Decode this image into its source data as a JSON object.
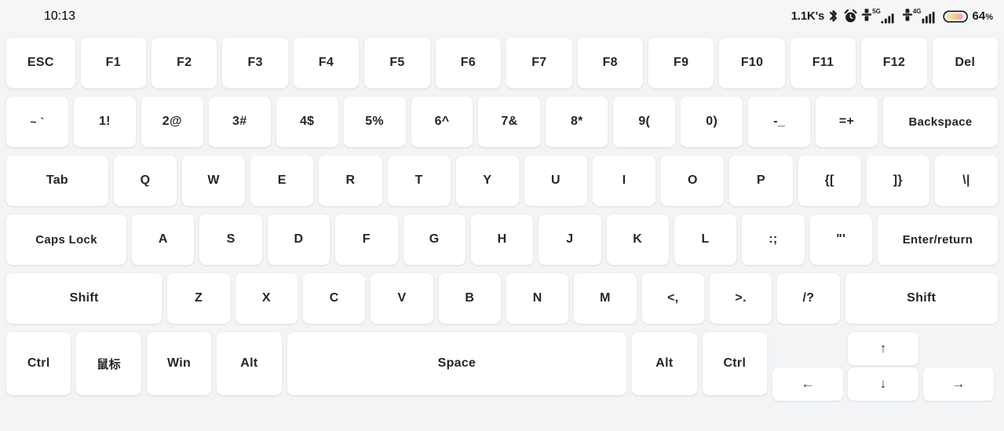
{
  "status_bar": {
    "clock": "10:13",
    "network_speed": "1.1K's",
    "icons": [
      {
        "name": "bluetooth-icon"
      },
      {
        "name": "alarm-clock-icon"
      },
      {
        "name": "sim1-signal-icon",
        "generation": "5G"
      },
      {
        "name": "sim2-signal-icon",
        "generation": "4G"
      }
    ],
    "battery_percent": "64",
    "battery_percent_sign": "%",
    "colors": {
      "bar_background": "#f5f6f8",
      "text": "#1c1d1f",
      "battery_fill_start": "#f7e08a",
      "battery_fill_end": "#f0a6b6"
    }
  },
  "keyboard": {
    "colors": {
      "background": "#f2f4f6",
      "key_face": "#ffffff",
      "key_border": "#eceef0",
      "key_text": "#24262a"
    },
    "rows": [
      {
        "name": "function-row",
        "keys": [
          {
            "label": "ESC"
          },
          {
            "label": "F1"
          },
          {
            "label": "F2"
          },
          {
            "label": "F3"
          },
          {
            "label": "F4"
          },
          {
            "label": "F5"
          },
          {
            "label": "F6"
          },
          {
            "label": "F7"
          },
          {
            "label": "F8"
          },
          {
            "label": "F9"
          },
          {
            "label": "F10"
          },
          {
            "label": "F11"
          },
          {
            "label": "F12"
          },
          {
            "label": "Del"
          }
        ]
      },
      {
        "name": "number-row",
        "keys": [
          {
            "label": "~ `"
          },
          {
            "label": "1!"
          },
          {
            "label": "2@"
          },
          {
            "label": "3#"
          },
          {
            "label": "4$"
          },
          {
            "label": "5%"
          },
          {
            "label": "6^"
          },
          {
            "label": "7&"
          },
          {
            "label": "8*"
          },
          {
            "label": "9("
          },
          {
            "label": "0)"
          },
          {
            "label": "-_"
          },
          {
            "label": "=+"
          },
          {
            "label": "Backspace"
          }
        ]
      },
      {
        "name": "qwerty-row",
        "keys": [
          {
            "label": "Tab"
          },
          {
            "label": "Q"
          },
          {
            "label": "W"
          },
          {
            "label": "E"
          },
          {
            "label": "R"
          },
          {
            "label": "T"
          },
          {
            "label": "Y"
          },
          {
            "label": "U"
          },
          {
            "label": "I"
          },
          {
            "label": "O"
          },
          {
            "label": "P"
          },
          {
            "label": "{["
          },
          {
            "label": "]}"
          },
          {
            "label": "\\|"
          }
        ]
      },
      {
        "name": "home-row",
        "keys": [
          {
            "label": "Caps Lock"
          },
          {
            "label": "A"
          },
          {
            "label": "S"
          },
          {
            "label": "D"
          },
          {
            "label": "F"
          },
          {
            "label": "G"
          },
          {
            "label": "H"
          },
          {
            "label": "J"
          },
          {
            "label": "K"
          },
          {
            "label": "L"
          },
          {
            "label": ":;"
          },
          {
            "label": "\"'"
          },
          {
            "label": "Enter/return"
          }
        ]
      },
      {
        "name": "shift-row",
        "keys": [
          {
            "label": "Shift"
          },
          {
            "label": "Z"
          },
          {
            "label": "X"
          },
          {
            "label": "C"
          },
          {
            "label": "V"
          },
          {
            "label": "B"
          },
          {
            "label": "N"
          },
          {
            "label": "M"
          },
          {
            "label": "<,"
          },
          {
            "label": ">."
          },
          {
            "label": "/?"
          },
          {
            "label": "Shift"
          }
        ]
      },
      {
        "name": "bottom-row",
        "keys": [
          {
            "label": "Ctrl"
          },
          {
            "label": "鼠标"
          },
          {
            "label": "Win"
          },
          {
            "label": "Alt"
          },
          {
            "label": "Space"
          },
          {
            "label": "Alt"
          },
          {
            "label": "Ctrl"
          }
        ]
      }
    ],
    "arrow_cluster": {
      "up": "↑",
      "left": "←",
      "down": "↓",
      "right": "→"
    }
  }
}
